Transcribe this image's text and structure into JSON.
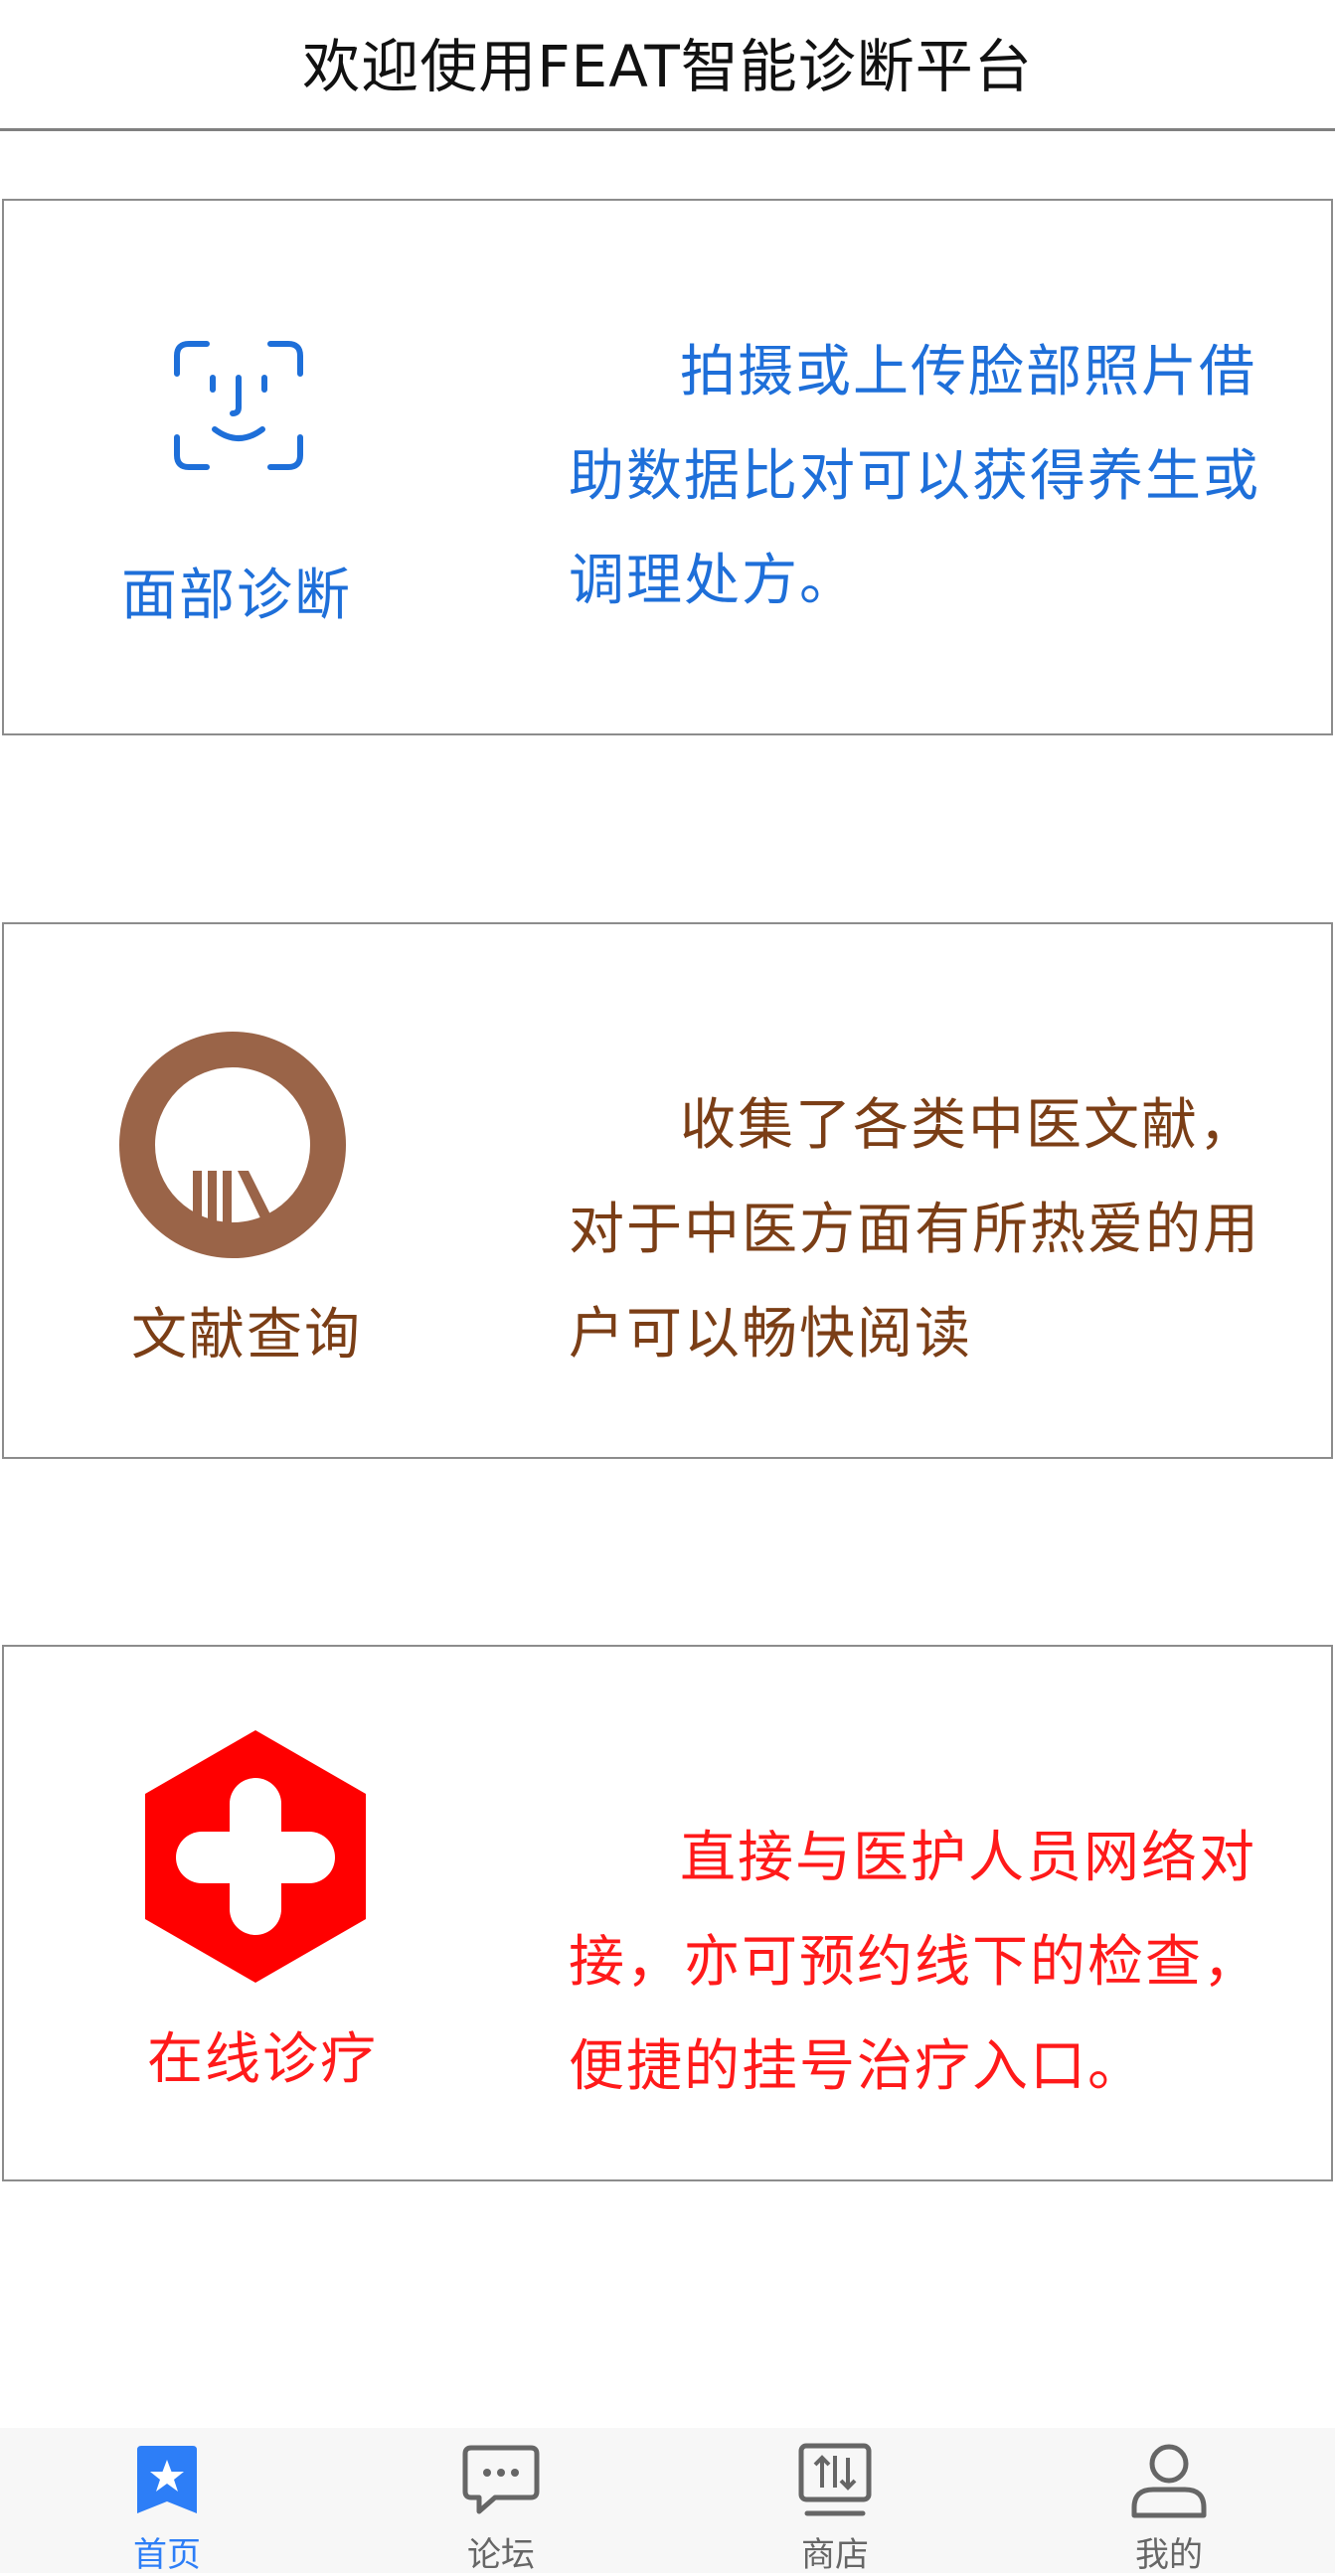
{
  "header": {
    "title": "欢迎使用FEAT智能诊断平台"
  },
  "cards": [
    {
      "label": "面部诊断",
      "description": "拍摄或上传脸部照片借助数据比对可以获得养生或调理处方。",
      "color": "#1e6fd9",
      "icon": "face-scan-icon"
    },
    {
      "label": "文献查询",
      "description": "收集了各类中医文献，对于中医方面有所热爱的用户可以畅快阅读",
      "color": "#7b3e16",
      "icon": "library-icon"
    },
    {
      "label": "在线诊疗",
      "description": "直接与医护人员网络对接，亦可预约线下的检查，便捷的挂号治疗入口。",
      "color": "#ff1a1a",
      "icon": "medical-cross-icon"
    }
  ],
  "tabbar": {
    "active_color": "#2d7ef7",
    "inactive_color": "#666666",
    "items": [
      {
        "label": "首页",
        "icon": "home-star-icon",
        "active": true
      },
      {
        "label": "论坛",
        "icon": "chat-bubble-icon",
        "active": false
      },
      {
        "label": "商店",
        "icon": "store-icon",
        "active": false
      },
      {
        "label": "我的",
        "icon": "user-icon",
        "active": false
      }
    ]
  }
}
